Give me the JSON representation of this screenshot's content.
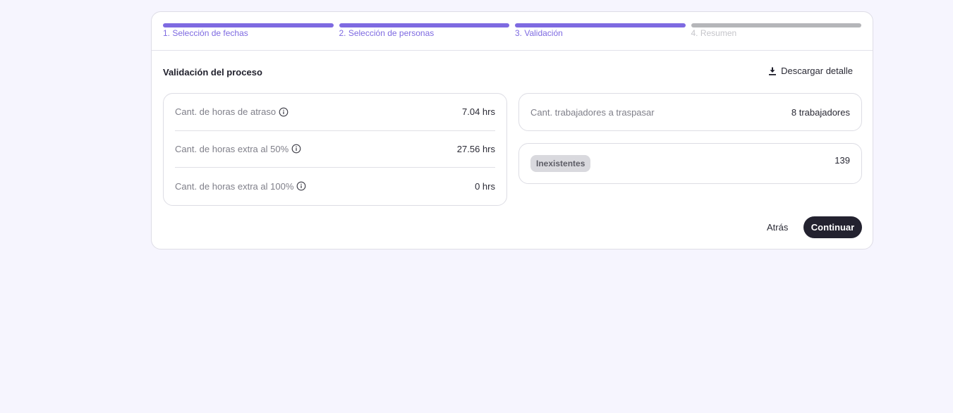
{
  "stepper": {
    "steps": [
      {
        "label": "1. Selección de fechas",
        "state": "done"
      },
      {
        "label": "2. Selección de personas",
        "state": "done"
      },
      {
        "label": "3. Validación",
        "state": "done"
      },
      {
        "label": "4. Resumen",
        "state": "pending"
      }
    ]
  },
  "header": {
    "title": "Validación del proceso",
    "download_label": "Descargar detalle",
    "download_icon": "download-icon"
  },
  "metrics": [
    {
      "label": "Cant. de horas de atraso",
      "value": "7.04 hrs",
      "icon": "info-icon"
    },
    {
      "label": "Cant. de horas extra al 50%",
      "value": "27.56 hrs",
      "icon": "info-icon"
    },
    {
      "label": "Cant. de horas extra al 100%",
      "value": "0 hrs",
      "icon": "info-icon"
    }
  ],
  "workers": {
    "label": "Cant. trabajadores a traspasar",
    "value": "8 trabajadores"
  },
  "nonexistent": {
    "badge": "Inexistentes",
    "value": "139"
  },
  "actions": {
    "back_label": "Atrás",
    "continue_label": "Continuar"
  },
  "colors": {
    "accent": "#7e6ae1",
    "pending": "#b5b6b9",
    "primary_button": "#23222f",
    "background": "#f6f5fe"
  }
}
